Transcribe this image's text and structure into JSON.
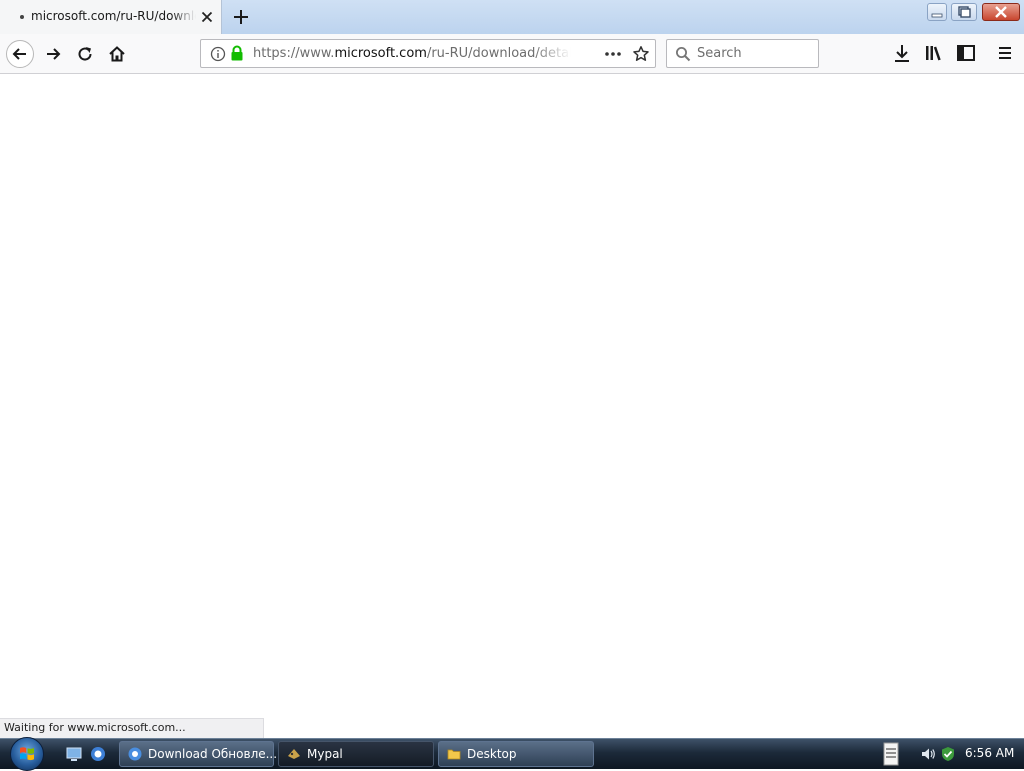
{
  "tab": {
    "title": "microsoft.com/ru-RU/download/details",
    "icons": {
      "loading": "loading-dot-icon",
      "close": "close-icon",
      "new_tab": "plus-icon"
    }
  },
  "window_controls": [
    "minimize-icon",
    "restore-icon",
    "close-icon"
  ],
  "toolbar": {
    "url_prefix": "https://www.",
    "url_host": "microsoft.com",
    "url_path": "/ru-RU/download/details",
    "search_placeholder": "Search",
    "icons": [
      "back-arrow-icon",
      "forward-arrow-icon",
      "reload-icon",
      "home-icon",
      "info-icon",
      "lock-icon",
      "more-actions-icon",
      "bookmark-star-icon",
      "search-icon",
      "download-icon",
      "library-icon",
      "sidebar-icon",
      "menu-icon"
    ]
  },
  "status_bar": {
    "text": "Waiting for www.microsoft.com..."
  },
  "taskbar": {
    "tasks": [
      {
        "label": "Download Обновле...",
        "icon": "browser-icon"
      },
      {
        "label": "Mypal",
        "icon": "mypal-app-icon"
      },
      {
        "label": "Desktop",
        "icon": "folder-icon"
      }
    ],
    "tray_icons": [
      "keyboard-icon",
      "volume-icon",
      "security-shield-icon"
    ],
    "clock": "6:56 AM"
  },
  "colors": {
    "lock": "#12bc00",
    "taskbar": "#1c2a3a",
    "tab_strip": "#bcd3ee"
  }
}
